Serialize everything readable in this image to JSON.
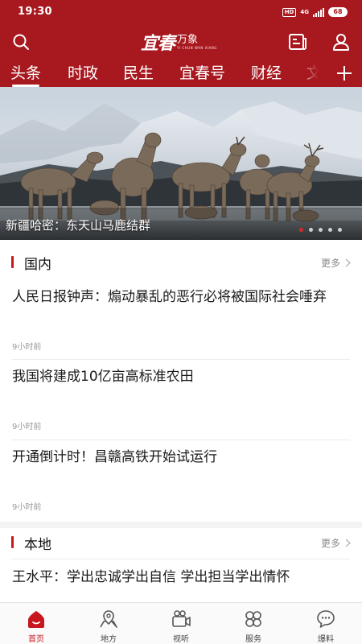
{
  "status_bar": {
    "time": "19:30",
    "hd": "HD",
    "network": "4G",
    "battery": "68"
  },
  "header": {
    "logo_main": "宜春",
    "logo_sub": "万象",
    "logo_pinyin": "YI CHUN WAN XIANG",
    "search_icon": "search-icon",
    "news_icon": "newspaper-icon",
    "user_icon": "user-icon"
  },
  "tabs": {
    "items": [
      "头条",
      "时政",
      "民生",
      "宜春号",
      "财经",
      "文"
    ],
    "active": "头条",
    "add_icon": "plus-icon"
  },
  "banner": {
    "caption": "新疆哈密：东天山马鹿结群",
    "dot_count": 5,
    "active_dot": 1
  },
  "domestic": {
    "title": "国内",
    "more": "更多",
    "items": [
      {
        "title": "人民日报钟声：煽动暴乱的恶行必将被国际社会唾弃",
        "time": "9小时前"
      },
      {
        "title": "我国将建成10亿亩高标准农田",
        "time": "9小时前"
      },
      {
        "title": "开通倒计时！昌赣高铁开始试运行",
        "time": "9小时前"
      }
    ]
  },
  "local": {
    "title": "本地",
    "more": "更多",
    "items": [
      {
        "title": "王水平：学出忠诚学出自信 学出担当学出情怀"
      }
    ]
  },
  "bottom_nav": {
    "items": [
      {
        "label": "首页",
        "icon": "home-icon"
      },
      {
        "label": "地方",
        "icon": "location-icon"
      },
      {
        "label": "视听",
        "icon": "video-camera-icon"
      },
      {
        "label": "服务",
        "icon": "services-grid-icon"
      },
      {
        "label": "爆料",
        "icon": "chat-bubble-icon"
      }
    ],
    "active": "首页"
  },
  "colors": {
    "brand_red": "#a8191f",
    "accent_red": "#c8161d",
    "muted_text": "#999999"
  }
}
